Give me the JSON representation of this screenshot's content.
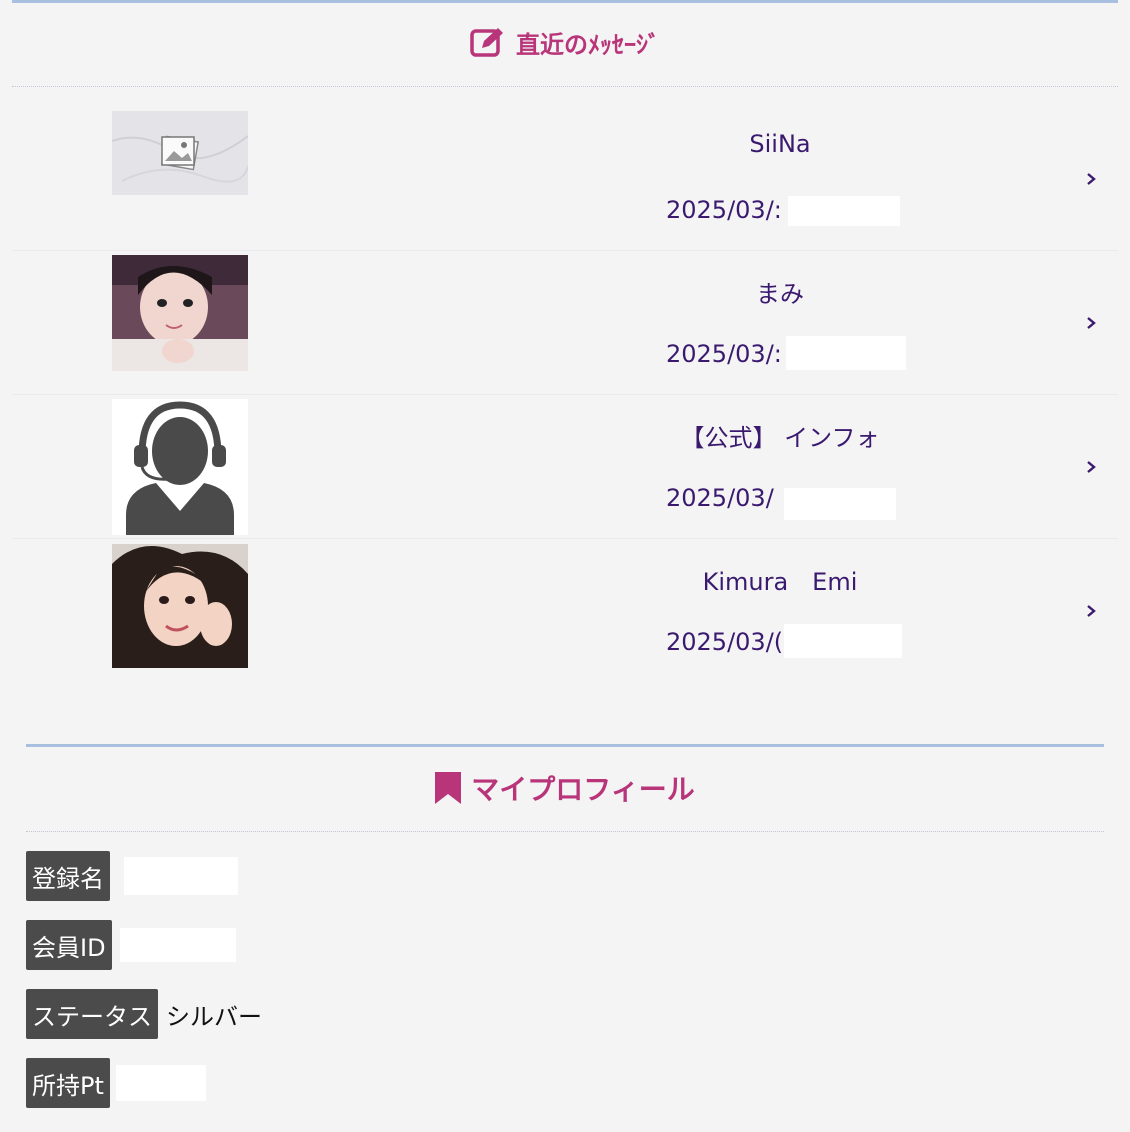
{
  "messages_section": {
    "title": "直近のﾒｯｾｰｼﾞ",
    "items": [
      {
        "name": "SiiNa",
        "date": "2025/03/:",
        "avatar": "marble-placeholder-image"
      },
      {
        "name": "まみ",
        "date": "2025/03/:",
        "avatar": "user-photo"
      },
      {
        "name": "【公式】 インフォ",
        "date": "2025/03/",
        "avatar": "support-operator-icon"
      },
      {
        "name": "Kimura　Emi",
        "date": "2025/03/(",
        "avatar": "user-photo"
      }
    ]
  },
  "profile_section": {
    "title": "マイプロフィール",
    "fields": [
      {
        "label": "登録名",
        "value": ""
      },
      {
        "label": "会員ID",
        "value": ""
      },
      {
        "label": "ステータス",
        "value": "シルバー"
      },
      {
        "label": "所持Pt",
        "value": ""
      }
    ]
  },
  "colors": {
    "accent": "#b8357a",
    "text": "#3a1a6e",
    "divider": "#a8bfe0"
  }
}
